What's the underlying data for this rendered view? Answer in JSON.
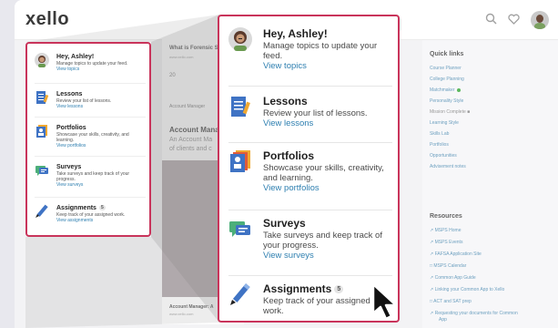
{
  "header": {
    "logo": "xello",
    "icons": [
      "search-icon",
      "heart-icon",
      "avatar"
    ]
  },
  "feed": {
    "card_title": "What is Forensic Sc",
    "card_sub": "www.xello.com",
    "reaction_count": "20",
    "section_label": "Account Manager",
    "heading": "Account Manag",
    "text_line1": "An Account Ma",
    "text_line2": "of clients and c",
    "footer_title": "Account Manager: A",
    "footer_sub": "www.xello.com"
  },
  "quick_links": {
    "title": "Quick links",
    "items": [
      "Course Planner",
      "College Planning",
      "Matchmaker",
      "Personality Style",
      "Mission Complete",
      "Learning Style",
      "Skills Lab",
      "Portfolios",
      "Opportunities",
      "Advisement notes"
    ]
  },
  "resources": {
    "title": "Resources",
    "items": [
      "MSPS Home",
      "MSPS Events",
      "FAFSA Application Site",
      "MSPS Calendar",
      "Common App Guide",
      "Linking your Common App to Xello",
      "ACT and SAT prep",
      "Requesting your documents for Common",
      "App"
    ]
  },
  "tasks": {
    "hey": {
      "title": "Hey, Ashley!",
      "desc": "Manage topics to update your feed.",
      "link": "View topics"
    },
    "lessons": {
      "title": "Lessons",
      "desc": "Review your list of lessons.",
      "link": "View lessons"
    },
    "portfolios": {
      "title": "Portfolios",
      "desc": "Showcase your skills, creativity, and learning.",
      "link": "View portfolios"
    },
    "surveys": {
      "title": "Surveys",
      "desc": "Take surveys and keep track of your progress.",
      "link": "View surveys"
    },
    "assignments": {
      "title": "Assignments",
      "badge": "5",
      "desc": "Keep track of your assigned work.",
      "link": "View assignments"
    }
  },
  "colors": {
    "highlight": "#c9345b",
    "link": "#2e7fb0",
    "lesson_icon": "#3f73c4",
    "portfolio_icon": "#f0a830",
    "survey_icon": "#4caf7a"
  }
}
